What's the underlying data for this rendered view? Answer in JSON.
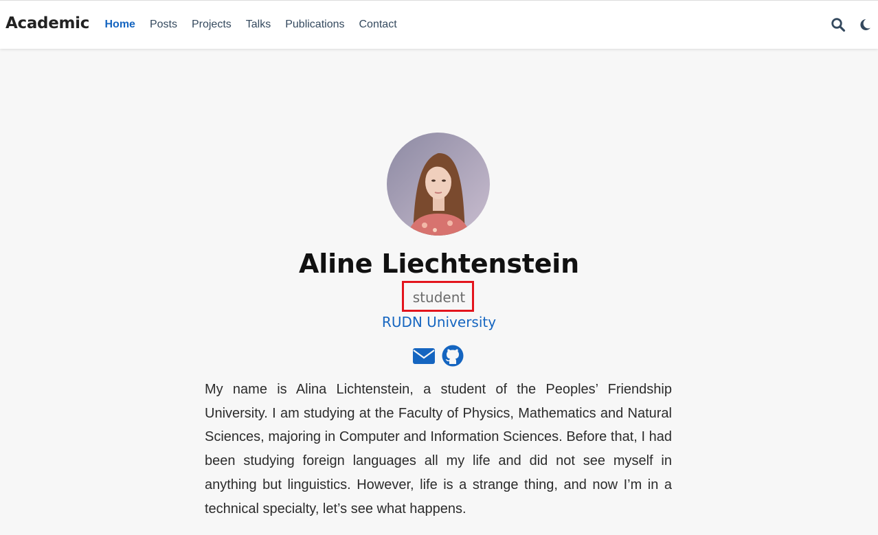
{
  "navbar": {
    "brand": "Academic",
    "links": [
      "Home",
      "Posts",
      "Projects",
      "Talks",
      "Publications",
      "Contact"
    ],
    "active_link": "Home",
    "icons": [
      "search-icon",
      "moon-icon"
    ]
  },
  "profile": {
    "name": "Aline Liechtenstein",
    "role": "student",
    "organization": "RUDN University",
    "social": [
      "envelope-icon",
      "github-icon"
    ],
    "bio": "My name is Alina Lichtenstein, a student of the Peoples’ Friendship University. I am studying at the Faculty of Physics, Mathematics and Natural Sciences, majoring in Computer and Information Sciences. Before that, I had been studying foreign languages all my life and did not see myself in anything but linguistics. However, life is a strange thing, and now I’m in a technical specialty, let’s see what happens."
  },
  "colors": {
    "accent": "#1565c0",
    "highlight_border": "#e3141c",
    "background": "#f7f7f7"
  }
}
